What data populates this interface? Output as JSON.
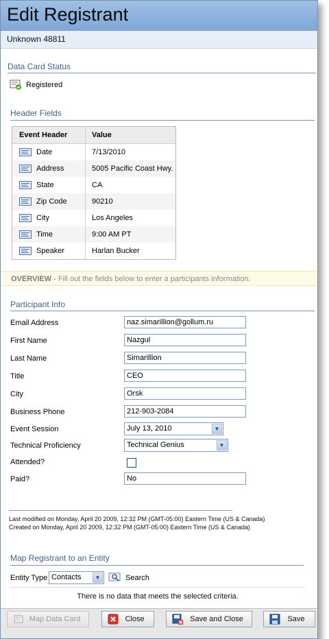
{
  "window": {
    "title": "Edit Registrant",
    "subtitle": "Unknown 48811"
  },
  "data_card_status": {
    "heading": "Data Card Status",
    "status": "Registered"
  },
  "header_fields": {
    "heading": "Header Fields",
    "columns": [
      "Event Header",
      "Value"
    ],
    "rows": [
      {
        "header": "Date",
        "value": "7/13/2010"
      },
      {
        "header": "Address",
        "value": "5005 Pacific Coast Hwy."
      },
      {
        "header": "State",
        "value": "CA"
      },
      {
        "header": "Zip Code",
        "value": "90210"
      },
      {
        "header": "City",
        "value": "Los Angeles"
      },
      {
        "header": "Time",
        "value": "9:00 AM PT"
      },
      {
        "header": "Speaker",
        "value": "Harlan Bucker"
      }
    ]
  },
  "overview": {
    "label": "OVERVIEW",
    "text": " - Fill out the fields below to enter a participants information."
  },
  "participant": {
    "heading": "Participant Info",
    "email": {
      "label": "Email Address",
      "value": "naz.simarillion@gollum.ru"
    },
    "first_name": {
      "label": "First Name",
      "value": "Nazgul"
    },
    "last_name": {
      "label": "Last Name",
      "value": "Simarillion"
    },
    "title": {
      "label": "Title",
      "value": "CEO"
    },
    "city": {
      "label": "City",
      "value": "Orsk"
    },
    "phone": {
      "label": "Business Phone",
      "value": "212-903-2084"
    },
    "session": {
      "label": "Event Session",
      "value": "July 13, 2010"
    },
    "proficiency": {
      "label": "Technical Proficiency",
      "value": "Technical Genius"
    },
    "attended": {
      "label": "Attended?",
      "checked": false
    },
    "paid": {
      "label": "Paid?",
      "value": "No"
    }
  },
  "meta": {
    "modified": "Last modified on Monday, April 20 2009, 12:32 PM (GMT-05:00) Eastern Time (US & Canada)",
    "created": "Created on Monday, April 20 2009, 12:32 PM (GMT-05:00) Eastern Time (US & Canada)"
  },
  "map_entity": {
    "heading": "Map Registrant to an Entity",
    "entity_type_label": "Entity Type",
    "entity_type_value": "Contacts",
    "search_label": "Search",
    "no_data": "There is no data that meets the selected criteria."
  },
  "footer": {
    "map_data_card": "Map Data Card",
    "close": "Close",
    "save_and_close": "Save and Close",
    "save": "Save"
  },
  "colors": {
    "title_bar": "#8fb2df",
    "section_text": "#41628c",
    "overview_bg": "#fdfbe6"
  }
}
